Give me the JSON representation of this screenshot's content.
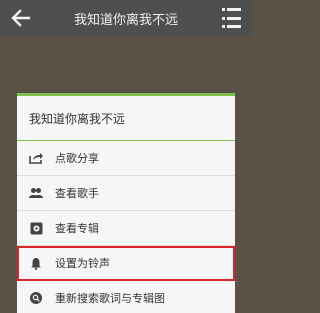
{
  "header": {
    "title": "我知道你离我不远",
    "back_icon": "back-arrow-icon",
    "menu_icon": "list-menu-icon"
  },
  "dialog": {
    "title": "我知道你离我不远",
    "accent_color": "#7fbf4d",
    "items": [
      {
        "label": "点歌分享",
        "icon": "share-icon"
      },
      {
        "label": "查看歌手",
        "icon": "people-icon"
      },
      {
        "label": "查看专辑",
        "icon": "album-icon"
      },
      {
        "label": "设置为铃声",
        "icon": "bell-icon"
      },
      {
        "label": "重新搜索歌词与专辑图",
        "icon": "search-refresh-icon"
      }
    ]
  },
  "colors": {
    "topbar": "#4f4f4f",
    "backdrop": "#5a5247",
    "highlight": "#d9252b"
  }
}
